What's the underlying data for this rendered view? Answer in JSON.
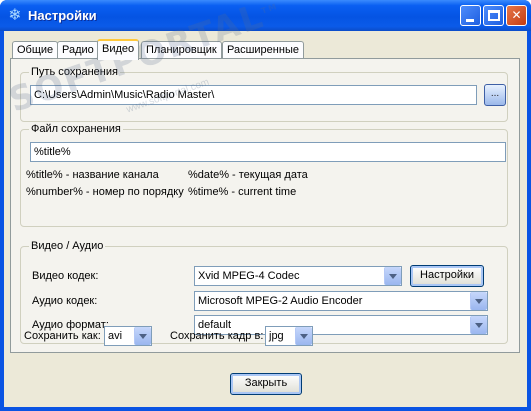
{
  "window": {
    "title": "Настройки",
    "icon": "snowflake-icon"
  },
  "tabs": [
    {
      "label": "Общие",
      "active": false
    },
    {
      "label": "Радио",
      "active": false
    },
    {
      "label": "Видео",
      "active": true
    },
    {
      "label": "Планировщик",
      "active": false
    },
    {
      "label": "Расширенные",
      "active": false
    }
  ],
  "save_path": {
    "group_label": "Путь сохранения",
    "value": "C:\\Users\\Admin\\Music\\Radio Master\\",
    "browse_label": "..."
  },
  "save_file": {
    "group_label": "Файл сохранения",
    "value": "%title%",
    "hints": {
      "title": "%title% - название канала",
      "date": "%date% - текущая дата",
      "number": "%number% - номер по порядку",
      "time": "%time% - current time"
    }
  },
  "video_audio": {
    "group_label": "Видео / Аудио",
    "video_codec_label": "Видео кодек:",
    "video_codec_value": "Xvid MPEG-4 Codec",
    "settings_button": "Настройки",
    "audio_codec_label": "Аудио кодек:",
    "audio_codec_value": "Microsoft MPEG-2 Audio Encoder",
    "audio_format_label": "Аудио формат:",
    "audio_format_value": "default"
  },
  "save_as": {
    "label": "Сохранить как:",
    "value": "avi"
  },
  "save_frame": {
    "label": "Сохранить кадр в:",
    "value": "jpg"
  },
  "close_button": "Закрыть",
  "watermark": {
    "text": "SOFTPORTAL",
    "url": "www.softportal.com",
    "tm": "TM"
  },
  "colors": {
    "titlebar": "#0554e3",
    "client_bg": "#ece9d8",
    "active_tab_accent": "#ffc83c"
  }
}
